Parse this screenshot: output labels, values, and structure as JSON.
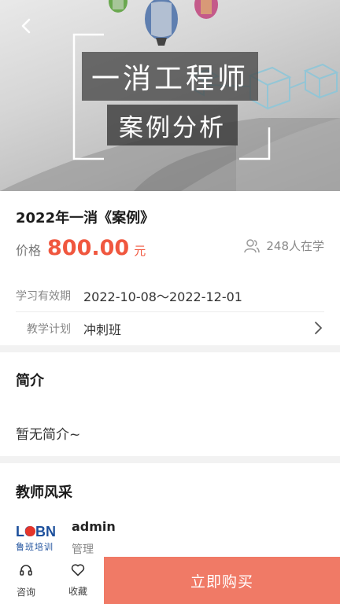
{
  "banner": {
    "title": "一消工程师",
    "subtitle": "案例分析"
  },
  "course": {
    "title": "2022年一消《案例》",
    "price_label": "价格",
    "price_value": "800.00",
    "price_unit": "元",
    "learners_text": "248人在学",
    "validity_label": "学习有效期",
    "validity_value": "2022-10-08～2022-12-01",
    "plan_label": "教学计划",
    "plan_value": "冲刺班"
  },
  "intro": {
    "title": "简介",
    "text": "暂无简介~"
  },
  "teachers": {
    "title": "教师风采",
    "items": [
      {
        "logo_text": "LOBN",
        "logo_sub": "鲁班培训",
        "name": "admin",
        "role": "管理"
      }
    ]
  },
  "bottom_bar": {
    "consult_label": "咨询",
    "favorite_label": "收藏",
    "buy_label": "立即购买"
  },
  "colors": {
    "accent": "#f0573f",
    "buy_button": "#f07a66"
  },
  "icons": {
    "back": "chevron-left-icon",
    "learners": "people-icon",
    "plan_arrow": "chevron-right-icon",
    "consult": "headset-icon",
    "favorite": "heart-icon"
  }
}
